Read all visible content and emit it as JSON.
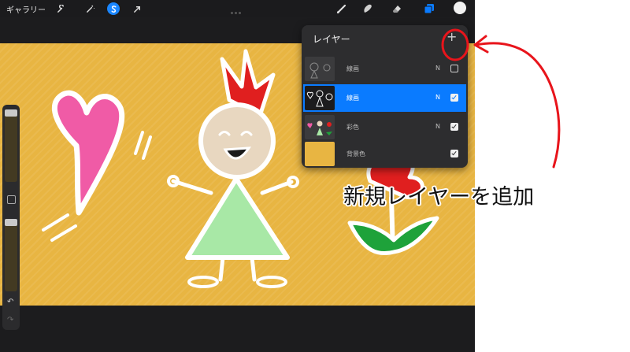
{
  "toolbar": {
    "gallery_label": "ギャラリー",
    "left_tools": [
      "wrench-icon",
      "magic-wand-icon",
      "selection-icon",
      "transform-icon"
    ],
    "active_tool": "selection-icon",
    "right_tools": [
      "brush-icon",
      "smudge-icon",
      "eraser-icon",
      "layers-icon"
    ],
    "color": "#f2f2f2"
  },
  "sidebar": {
    "brush_size": 0.1,
    "opacity": 0.1
  },
  "layers_panel": {
    "title": "レイヤー",
    "add_label": "+",
    "layers": [
      {
        "name": "線画",
        "blend": "N",
        "visible": false,
        "selected": false
      },
      {
        "name": "線画",
        "blend": "N",
        "visible": true,
        "selected": true
      },
      {
        "name": "彩色",
        "blend": "N",
        "visible": true,
        "selected": false
      },
      {
        "name": "背景色",
        "blend": "",
        "visible": true,
        "selected": false
      }
    ],
    "background_color": "#e8b542"
  },
  "annotation": {
    "text": "新規レイヤーを追加",
    "color": "#e8141b"
  }
}
